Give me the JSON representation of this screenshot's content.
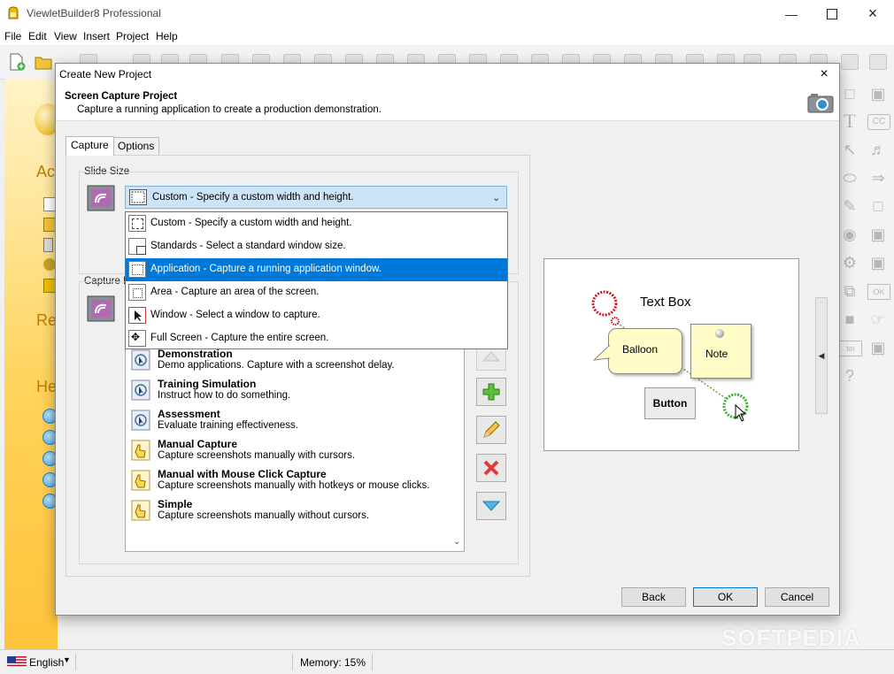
{
  "app": {
    "title": "ViewletBuilder8 Professional",
    "menu": [
      "File",
      "Edit",
      "View",
      "Insert",
      "Project",
      "Help"
    ]
  },
  "start_page": {
    "headings": [
      "Act",
      "Re",
      "He"
    ]
  },
  "status_bar": {
    "language": "English",
    "memory": "Memory: 15%"
  },
  "watermark": "SOFTPEDIA",
  "dialog": {
    "title": "Create New Project",
    "heading": "Screen Capture Project",
    "description": "Capture a running application to create a production demonstration.",
    "tabs": [
      {
        "label": "Capture",
        "active": true
      },
      {
        "label": "Options",
        "active": false
      }
    ],
    "slide_size_label": "Slide Size",
    "capture_label": "Capture P",
    "slide_size_selected": "Custom - Specify a custom width and height.",
    "slide_size_options": [
      {
        "label": "Custom - Specify a custom width and height.",
        "selected": false
      },
      {
        "label": "Standards - Select a standard window size.",
        "selected": false
      },
      {
        "label": "Application - Capture a running application window.",
        "selected": true
      },
      {
        "label": "Area - Capture an area of the screen.",
        "selected": false
      },
      {
        "label": "Window - Select a window to capture.",
        "selected": false
      },
      {
        "label": "Full Screen - Capture the entire screen.",
        "selected": false
      }
    ],
    "templates": [
      {
        "title": "Demonstration",
        "desc": "Demo applications. Capture with a screenshot delay.",
        "icon": "cursor"
      },
      {
        "title": "Training Simulation",
        "desc": "Instruct how to do something.",
        "icon": "cursor"
      },
      {
        "title": "Assessment",
        "desc": "Evaluate training effectiveness.",
        "icon": "cursor"
      },
      {
        "title": "Manual Capture",
        "desc": "Capture screenshots manually with cursors.",
        "icon": "hand"
      },
      {
        "title": "Manual with Mouse Click Capture",
        "desc": "Capture screenshots manually with hotkeys or mouse clicks.",
        "icon": "hand"
      },
      {
        "title": "Simple",
        "desc": "Capture screenshots manually without cursors.",
        "icon": "hand"
      }
    ],
    "preview": {
      "text_box": "Text Box",
      "balloon": "Balloon",
      "note": "Note",
      "button": "Button"
    },
    "buttons": {
      "back": "Back",
      "ok": "OK",
      "cancel": "Cancel"
    }
  },
  "colors": {
    "selection": "#0078d7",
    "combo_bg": "#cde4f7",
    "startpage": "#ffc33a"
  }
}
